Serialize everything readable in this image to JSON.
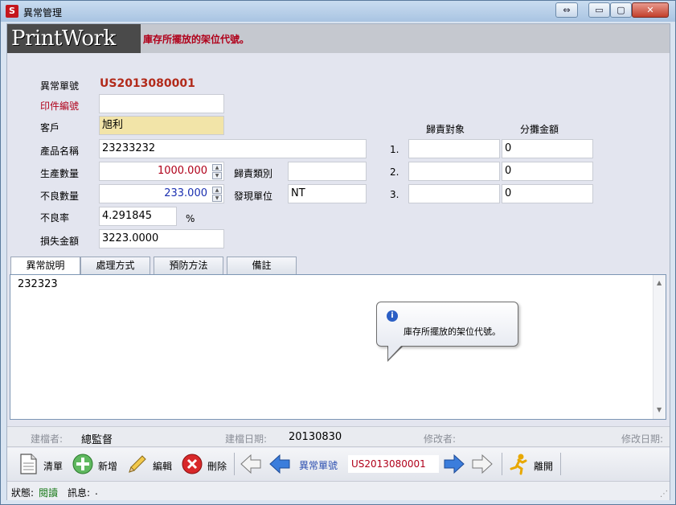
{
  "window": {
    "title": "異常管理",
    "app_icon": "S",
    "restore_icon": "⇔",
    "min_icon": "▭",
    "max_icon": "▢",
    "close_icon": "✕"
  },
  "header": {
    "logo": "PrintWork",
    "hint": "庫存所擺放的架位代號。"
  },
  "form": {
    "exception_no_label": "異常單號",
    "exception_no": "US2013080001",
    "print_no_label": "印件編號",
    "print_no": "",
    "customer_label": "客戶",
    "customer": "旭利",
    "product_label": "產品名稱",
    "product": "23233232",
    "prod_qty_label": "生產數量",
    "prod_qty": "1000.000",
    "defect_qty_label": "不良數量",
    "defect_qty": "233.000",
    "defect_rate_label": "不良率",
    "defect_rate": "4.291845",
    "percent": "%",
    "loss_label": "損失金額",
    "loss": "3223.0000",
    "resp_type_label": "歸責類別",
    "resp_type": "",
    "found_unit_label": "發現單位",
    "found_unit": "NT"
  },
  "allocation": {
    "col_target": "歸責對象",
    "col_amount": "分攤金額",
    "rows": [
      {
        "no": "1.",
        "target": "",
        "amount": "0"
      },
      {
        "no": "2.",
        "target": "",
        "amount": "0"
      },
      {
        "no": "3.",
        "target": "",
        "amount": "0"
      }
    ]
  },
  "tabs": [
    {
      "label": "異常說明",
      "active": true
    },
    {
      "label": "處理方式",
      "active": false
    },
    {
      "label": "預防方法",
      "active": false
    },
    {
      "label": "備註",
      "active": false
    }
  ],
  "tab_content": "232323",
  "scroll": {
    "up": "▲",
    "down": "▼"
  },
  "balloon": {
    "icon": "i",
    "text": "庫存所擺放的架位代號。"
  },
  "audit": {
    "creator_label": "建檔者:",
    "creator": "總監督",
    "created_label": "建檔日期:",
    "created": "20130830",
    "modifier_label": "修改者:",
    "modifier": "",
    "modified_label": "修改日期:",
    "modified": ""
  },
  "toolbar": {
    "clear": "清單",
    "add": "新增",
    "edit": "編輯",
    "delete": "刪除",
    "nav_label": "異常單號",
    "nav_value": "US2013080001",
    "exit": "離開"
  },
  "status": {
    "state_label": "狀態:",
    "state": "閱讀",
    "msg_label": "訊息:",
    "msg": "."
  }
}
